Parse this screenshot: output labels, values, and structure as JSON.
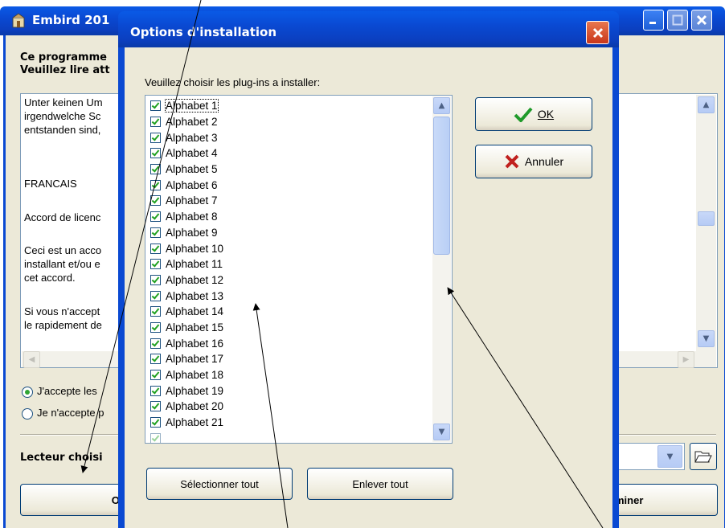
{
  "background_window": {
    "title": "Embird 201",
    "heading_line1": "Ce programme",
    "heading_line2": "Veuillez lire att",
    "license_lines": [
      "Unter keinen Um",
      "irgendwelche Sc",
      "entstanden sind,",
      "",
      "FRANCAIS",
      "Accord de licenc",
      "Ceci est un acco",
      "installant et/ou e",
      "cet accord.",
      "Si vous n'accept",
      "le rapidement de"
    ],
    "radio_accept": "J'accepte les",
    "radio_decline": "Je n'accepte p",
    "drive_label": "Lecteur choisi",
    "button_left": "Opt",
    "button_right": "miner"
  },
  "dialog": {
    "title": "Options d'installation",
    "prompt": "Veuillez choisir les plug-ins a installer:",
    "items": [
      "Alphabet 1",
      "Alphabet 2",
      "Alphabet 3",
      "Alphabet 4",
      "Alphabet 5",
      "Alphabet 6",
      "Alphabet 7",
      "Alphabet 8",
      "Alphabet 9",
      "Alphabet 10",
      "Alphabet 11",
      "Alphabet 12",
      "Alphabet 13",
      "Alphabet 14",
      "Alphabet 15",
      "Alphabet 16",
      "Alphabet 17",
      "Alphabet 18",
      "Alphabet 19",
      "Alphabet 20",
      "Alphabet 21"
    ],
    "ok_label": "OK",
    "cancel_label": "Annuler",
    "select_all_label": "Sélectionner tout",
    "remove_all_label": "Enlever tout"
  },
  "colors": {
    "title_blue": "#0a49d2",
    "close_red": "#e04a2a",
    "check_green": "#21a121"
  },
  "icons": [
    "app-icon",
    "minimize-icon",
    "maximize-icon",
    "close-icon",
    "checkmark-icon",
    "x-icon",
    "folder-open-icon",
    "chevron-up-icon",
    "chevron-down-icon",
    "arrow-icon"
  ]
}
